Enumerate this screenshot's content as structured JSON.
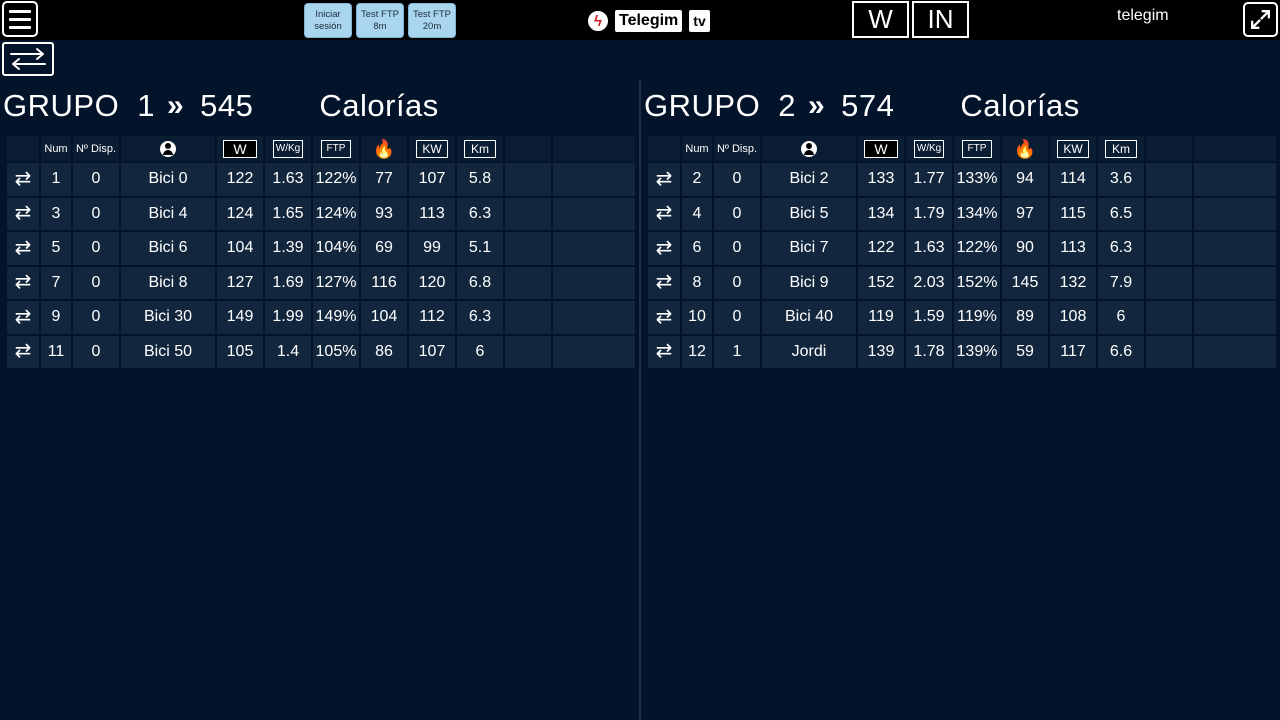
{
  "topbar": {
    "buttons": [
      "Iniciar sesión",
      "Test FTP 8m",
      "Test FTP 20m"
    ],
    "logo_text": "Telegim",
    "logo_tv": "tv",
    "mode_w": "W",
    "mode_in": "IN",
    "user": "telegim"
  },
  "columns": {
    "num": "Num",
    "disp": "Nº Disp.",
    "w": "W",
    "wkg": "W/Kg",
    "ftp": "FTP",
    "kw": "KW",
    "km": "Km"
  },
  "groups": [
    {
      "word": "GRUPO",
      "number": "1",
      "value": "545",
      "metric": "Calorías",
      "rows": [
        {
          "num": "1",
          "disp": "0",
          "name": "Bici 0",
          "w": "122",
          "wkg": "1.63",
          "ftp": "122%",
          "cal": "77",
          "kw": "107",
          "km": "5.8"
        },
        {
          "num": "3",
          "disp": "0",
          "name": "Bici 4",
          "w": "124",
          "wkg": "1.65",
          "ftp": "124%",
          "cal": "93",
          "kw": "113",
          "km": "6.3"
        },
        {
          "num": "5",
          "disp": "0",
          "name": "Bici 6",
          "w": "104",
          "wkg": "1.39",
          "ftp": "104%",
          "cal": "69",
          "kw": "99",
          "km": "5.1"
        },
        {
          "num": "7",
          "disp": "0",
          "name": "Bici 8",
          "w": "127",
          "wkg": "1.69",
          "ftp": "127%",
          "cal": "116",
          "kw": "120",
          "km": "6.8"
        },
        {
          "num": "9",
          "disp": "0",
          "name": "Bici 30",
          "w": "149",
          "wkg": "1.99",
          "ftp": "149%",
          "cal": "104",
          "kw": "112",
          "km": "6.3"
        },
        {
          "num": "11",
          "disp": "0",
          "name": "Bici 50",
          "w": "105",
          "wkg": "1.4",
          "ftp": "105%",
          "cal": "86",
          "kw": "107",
          "km": "6"
        }
      ]
    },
    {
      "word": "GRUPO",
      "number": "2",
      "value": "574",
      "metric": "Calorías",
      "rows": [
        {
          "num": "2",
          "disp": "0",
          "name": "Bici 2",
          "w": "133",
          "wkg": "1.77",
          "ftp": "133%",
          "cal": "94",
          "kw": "114",
          "km": "3.6"
        },
        {
          "num": "4",
          "disp": "0",
          "name": "Bici 5",
          "w": "134",
          "wkg": "1.79",
          "ftp": "134%",
          "cal": "97",
          "kw": "115",
          "km": "6.5"
        },
        {
          "num": "6",
          "disp": "0",
          "name": "Bici 7",
          "w": "122",
          "wkg": "1.63",
          "ftp": "122%",
          "cal": "90",
          "kw": "113",
          "km": "6.3"
        },
        {
          "num": "8",
          "disp": "0",
          "name": "Bici 9",
          "w": "152",
          "wkg": "2.03",
          "ftp": "152%",
          "cal": "145",
          "kw": "132",
          "km": "7.9"
        },
        {
          "num": "10",
          "disp": "0",
          "name": "Bici 40",
          "w": "119",
          "wkg": "1.59",
          "ftp": "119%",
          "cal": "89",
          "kw": "108",
          "km": "6"
        },
        {
          "num": "12",
          "disp": "1",
          "name": "Jordi",
          "w": "139",
          "wkg": "1.78",
          "ftp": "139%",
          "cal": "59",
          "kw": "117",
          "km": "6.6"
        }
      ]
    }
  ]
}
